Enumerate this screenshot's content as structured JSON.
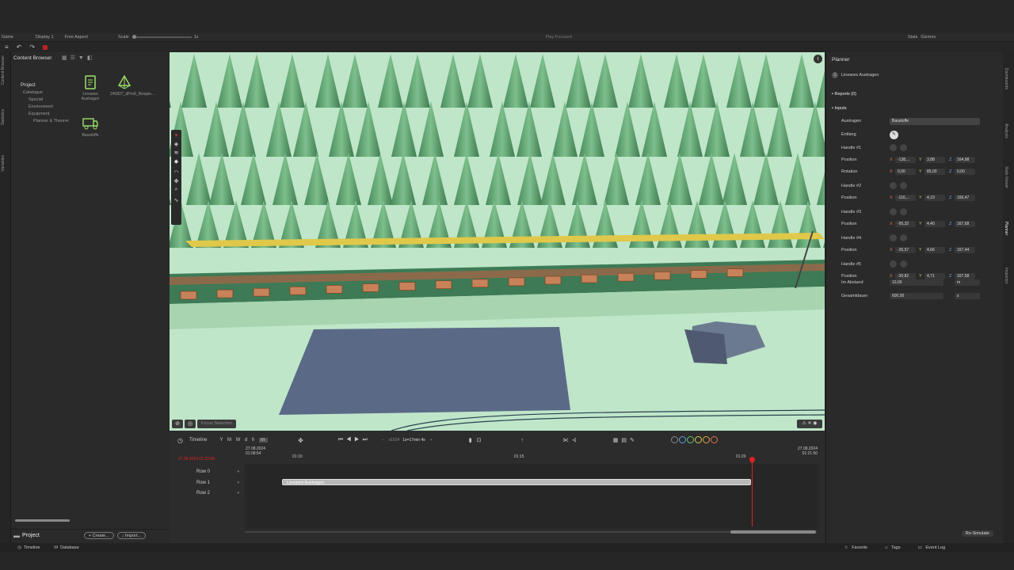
{
  "gamebar": {
    "mode": "Game",
    "display": "Display 1",
    "aspect": "Free Aspect",
    "scale_label": "Scale",
    "scale_value": "1x",
    "play_focused": "Play Focused",
    "stats": "Stats",
    "gizmos": "Gizmos"
  },
  "left_tabs": [
    "Content Browser",
    "Statistics",
    "Variables"
  ],
  "content": {
    "title": "Content Browser",
    "project_label": "Project",
    "tree": [
      "Catalogue",
      "Special",
      "Environment",
      "Equipment",
      "Planner & Theurer"
    ],
    "assets": [
      {
        "name": "Lineares Austragen",
        "icon": "document-icon"
      },
      {
        "name": "240827_dPro8_Beispie...",
        "icon": "mesh-icon"
      },
      {
        "name": "Baustoffe",
        "icon": "truck-icon"
      }
    ],
    "footer_title": "Project",
    "create_label": "Create...",
    "import_label": "Import..."
  },
  "viewport": {
    "focus_label": "Focus Selection"
  },
  "timeline": {
    "title": "Timeline",
    "scales": [
      "Y",
      "M",
      "W",
      "d",
      "h",
      "m"
    ],
    "speed": "x1024",
    "duration": "1s=17min 4s",
    "start_date": "27.08.2024",
    "start_time": "01:08:54",
    "current": "27.08.2024 01:20:08",
    "end_date": "27.08.2024",
    "end_time": "01:21:50",
    "ticks": [
      "01:10",
      "01:15",
      "01:20"
    ],
    "rows": [
      "Row 0",
      "Row 1",
      "Row 2"
    ],
    "bar_label": "Lineares Austragen",
    "colors": [
      "#888888",
      "#5aa0d8",
      "#6cc070",
      "#d8c85a",
      "#e0a040",
      "#e07050"
    ]
  },
  "planner": {
    "title": "Planner",
    "item": "Lineares Austragen",
    "reports": "Reports (0)",
    "inputs": "Inputs",
    "austragen_label": "Austragen",
    "austragen_value": "Baustoffe",
    "entlang_label": "Entlang",
    "handles": [
      {
        "name": "Handle #1",
        "rows": [
          {
            "label": "Position",
            "x": "-138,...",
            "y": "3,88",
            "z": "164,98"
          },
          {
            "label": "Rotation",
            "x": "0,00",
            "y": "85,00",
            "z": "0,00"
          }
        ]
      },
      {
        "name": "Handle #2",
        "rows": [
          {
            "label": "Position",
            "x": "-116,...",
            "y": "4,19",
            "z": "166,47"
          }
        ]
      },
      {
        "name": "Handle #3",
        "rows": [
          {
            "label": "Position",
            "x": "-95,32",
            "y": "4,40",
            "z": "167,68"
          }
        ]
      },
      {
        "name": "Handle #4",
        "rows": [
          {
            "label": "Position",
            "x": "-35,57",
            "y": "4,66",
            "z": "167,44"
          }
        ]
      },
      {
        "name": "Handle #5",
        "rows": [
          {
            "label": "Position",
            "x": "-30,82",
            "y": "4,71",
            "z": "167,58"
          }
        ]
      }
    ],
    "abstand_label": "Im Abstand",
    "abstand_value": "10,00",
    "abstand_unit": "m",
    "dauer_label": "Gesamtdauer",
    "dauer_value": "600,00",
    "dauer_unit": "s",
    "resimulate": "Re-Simulate"
  },
  "right_tabs": [
    "Dashboards",
    "Analysis",
    "Stats Viewer",
    "Planner",
    "Inspector"
  ],
  "statusbar": {
    "timeline": "Timeline",
    "database": "Database",
    "favorite": "Favorite",
    "tags": "Tags",
    "eventlog": "Event Log"
  }
}
